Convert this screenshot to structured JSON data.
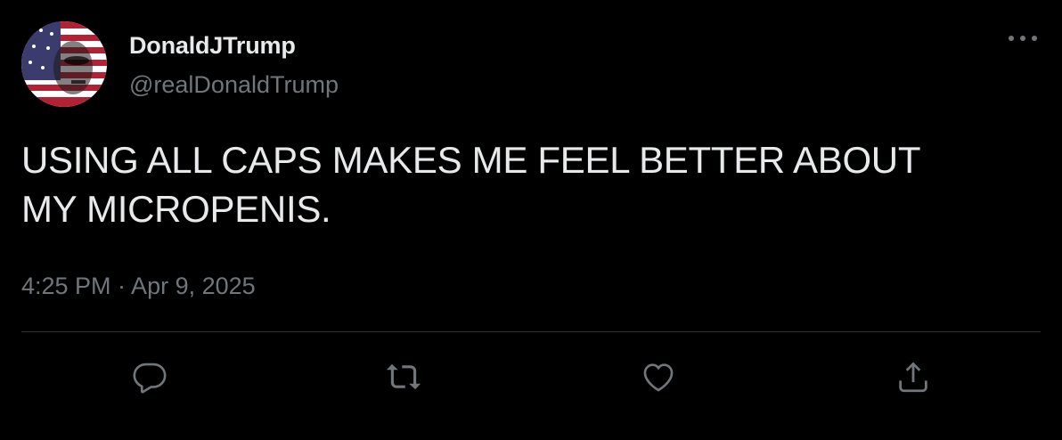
{
  "author": {
    "display_name": "DonaldJTrump",
    "handle": "@realDonaldTrump"
  },
  "tweet": {
    "text_line1": "USING ALL CAPS MAKES ME FEEL BETTER ABOUT",
    "text_line2": "MY MICROPENIS.",
    "timestamp": "4:25 PM · Apr 9, 2025"
  },
  "icons": {
    "more": "more-horizontal-icon",
    "reply": "reply-icon",
    "retweet": "retweet-icon",
    "like": "heart-icon",
    "share": "share-icon"
  },
  "colors": {
    "background": "#000000",
    "text_primary": "#e7e9ea",
    "text_secondary": "#71767b",
    "divider": "#2f3336"
  }
}
